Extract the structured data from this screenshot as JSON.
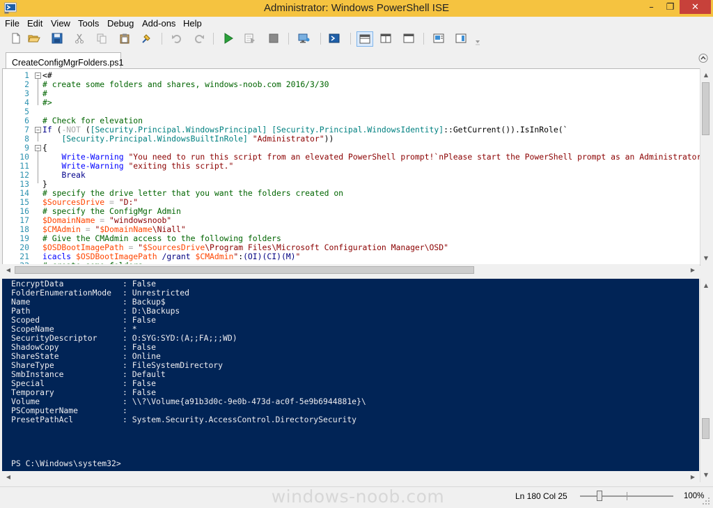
{
  "window": {
    "title": "Administrator: Windows PowerShell ISE",
    "minimize": "–",
    "maximize": "❐",
    "close": "✕"
  },
  "menu": [
    "File",
    "Edit",
    "View",
    "Tools",
    "Debug",
    "Add-ons",
    "Help"
  ],
  "toolbar_icons": [
    "new-script-icon",
    "open-icon",
    "save-icon",
    "cut-icon",
    "copy-icon",
    "paste-icon",
    "clear-console-icon",
    "undo-icon",
    "redo-icon",
    "run-script-icon",
    "run-selection-icon",
    "stop-icon",
    "new-remote-tab-icon",
    "start-powershell-icon",
    "script-pane-top-icon",
    "script-pane-right-icon",
    "script-pane-max-icon",
    "show-commands-icon",
    "show-addon-icon"
  ],
  "tab": {
    "label": "CreateConfigMgrFolders.ps1"
  },
  "editor": {
    "lines": [
      {
        "n": "1",
        "segs": [
          [
            "pl",
            "<#"
          ]
        ]
      },
      {
        "n": "2",
        "segs": [
          [
            "com",
            "# create some folders and shares, windows-noob.com 2016/3/30"
          ]
        ]
      },
      {
        "n": "3",
        "segs": [
          [
            "com",
            "#"
          ]
        ]
      },
      {
        "n": "4",
        "segs": [
          [
            "com",
            "#>"
          ]
        ]
      },
      {
        "n": "5",
        "segs": []
      },
      {
        "n": "6",
        "segs": [
          [
            "com",
            "# Check for elevation"
          ]
        ]
      },
      {
        "n": "7",
        "segs": [
          [
            "kw",
            "If"
          ],
          [
            "pl",
            " ("
          ],
          [
            "op",
            "-NOT"
          ],
          [
            "pl",
            " ("
          ],
          [
            "type",
            "[Security.Principal.WindowsPrincipal]"
          ],
          [
            "pl",
            " "
          ],
          [
            "type",
            "[Security.Principal.WindowsIdentity]"
          ],
          [
            "pl",
            "::"
          ],
          [
            "mem",
            "GetCurrent"
          ],
          [
            "pl",
            "())."
          ],
          [
            "mem",
            "IsInRole"
          ],
          [
            "pl",
            "(`"
          ]
        ]
      },
      {
        "n": "8",
        "segs": [
          [
            "pl",
            "    "
          ],
          [
            "type",
            "[Security.Principal.WindowsBuiltInRole]"
          ],
          [
            "pl",
            " "
          ],
          [
            "str",
            "\"Administrator\""
          ],
          [
            "pl",
            "))"
          ]
        ]
      },
      {
        "n": "9",
        "segs": [
          [
            "pl",
            "{"
          ]
        ]
      },
      {
        "n": "10",
        "segs": [
          [
            "pl",
            "    "
          ],
          [
            "cmd",
            "Write-Warning"
          ],
          [
            "pl",
            " "
          ],
          [
            "str",
            "\"You need to run this script from an elevated PowerShell prompt!`nPlease start the PowerShell prompt as an Administrator"
          ]
        ]
      },
      {
        "n": "11",
        "segs": [
          [
            "pl",
            "    "
          ],
          [
            "cmd",
            "Write-Warning"
          ],
          [
            "pl",
            " "
          ],
          [
            "str",
            "\"exiting this script.\""
          ]
        ]
      },
      {
        "n": "12",
        "segs": [
          [
            "pl",
            "    "
          ],
          [
            "kw",
            "Break"
          ]
        ]
      },
      {
        "n": "13",
        "segs": [
          [
            "pl",
            "}"
          ]
        ]
      },
      {
        "n": "14",
        "segs": [
          [
            "com",
            "# specify the drive letter that you want the folders created on"
          ]
        ]
      },
      {
        "n": "15",
        "segs": [
          [
            "var",
            "$SourcesDrive"
          ],
          [
            "pl",
            " "
          ],
          [
            "op",
            "="
          ],
          [
            "pl",
            " "
          ],
          [
            "str",
            "\"D:\""
          ]
        ]
      },
      {
        "n": "16",
        "segs": [
          [
            "com",
            "# specify the ConfigMgr Admin"
          ]
        ]
      },
      {
        "n": "17",
        "segs": [
          [
            "var",
            "$DomainName"
          ],
          [
            "pl",
            " "
          ],
          [
            "op",
            "="
          ],
          [
            "pl",
            " "
          ],
          [
            "str",
            "\"windowsnoob\""
          ]
        ]
      },
      {
        "n": "18",
        "segs": [
          [
            "var",
            "$CMAdmin"
          ],
          [
            "pl",
            " "
          ],
          [
            "op",
            "="
          ],
          [
            "pl",
            " "
          ],
          [
            "str",
            "\""
          ],
          [
            "var",
            "$DomainName"
          ],
          [
            "str",
            "\\Niall\""
          ]
        ]
      },
      {
        "n": "19",
        "segs": [
          [
            "com",
            "# Give the CMAdmin access to the following folders"
          ]
        ]
      },
      {
        "n": "20",
        "segs": [
          [
            "var",
            "$OSDBootImagePath"
          ],
          [
            "pl",
            " "
          ],
          [
            "op",
            "="
          ],
          [
            "pl",
            " "
          ],
          [
            "str",
            "\""
          ],
          [
            "var",
            "$SourcesDrive"
          ],
          [
            "str",
            "\\Program Files\\Microsoft Configuration Manager\\OSD\""
          ]
        ]
      },
      {
        "n": "21",
        "segs": [
          [
            "cmd",
            "icacls"
          ],
          [
            "pl",
            " "
          ],
          [
            "var",
            "$OSDBootImagePath"
          ],
          [
            "pl",
            " "
          ],
          [
            "param",
            "/grant"
          ],
          [
            "pl",
            " "
          ],
          [
            "var",
            "$CMAdmin"
          ],
          [
            "str",
            "\""
          ],
          [
            "pl",
            ":"
          ],
          [
            "param",
            "(OI)(CI)(M)"
          ],
          [
            "str",
            "\""
          ]
        ]
      },
      {
        "n": "22",
        "segs": [
          [
            "com",
            "# create some folders"
          ]
        ]
      }
    ]
  },
  "console": {
    "rows": [
      [
        "EncryptData",
        ": False"
      ],
      [
        "FolderEnumerationMode",
        ": Unrestricted"
      ],
      [
        "Name",
        ": Backup$"
      ],
      [
        "Path",
        ": D:\\Backups"
      ],
      [
        "Scoped",
        ": False"
      ],
      [
        "ScopeName",
        ": *"
      ],
      [
        "SecurityDescriptor",
        ": O:SYG:SYD:(A;;FA;;;WD)"
      ],
      [
        "ShadowCopy",
        ": False"
      ],
      [
        "ShareState",
        ": Online"
      ],
      [
        "ShareType",
        ": FileSystemDirectory"
      ],
      [
        "SmbInstance",
        ": Default"
      ],
      [
        "Special",
        ": False"
      ],
      [
        "Temporary",
        ": False"
      ],
      [
        "Volume",
        ": \\\\?\\Volume{a91b3d0c-9e0b-473d-ac0f-5e9b6944881e}\\"
      ],
      [
        "PSComputerName",
        ":"
      ],
      [
        "PresetPathAcl",
        ": System.Security.AccessControl.DirectorySecurity"
      ]
    ],
    "prompt": "PS C:\\Windows\\system32>"
  },
  "status": {
    "watermark": "windows-noob.com",
    "position": "Ln 180  Col 25",
    "zoom": "100%",
    "zoom_level": 1.0
  },
  "colors": {
    "titlebar": "#f5c340",
    "console_bg": "#012456",
    "console_fg": "#eeedf0",
    "comment": "#006400",
    "variable": "#ff4500",
    "string": "#8b0000",
    "type": "#008080",
    "command": "#0000ff"
  }
}
